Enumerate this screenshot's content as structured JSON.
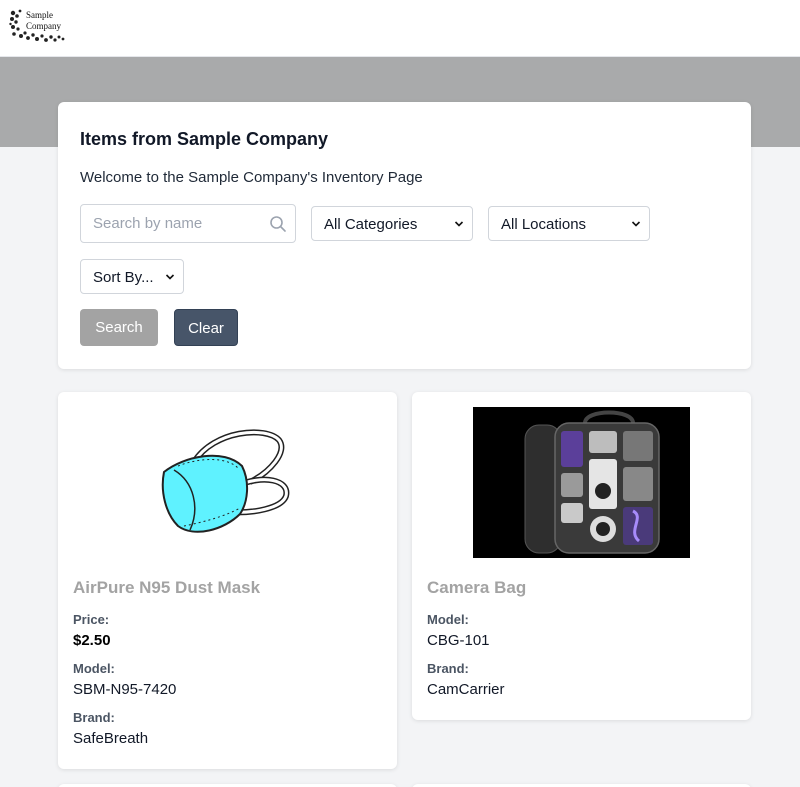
{
  "header": {
    "logo_text_line1": "Sample",
    "logo_text_line2": "Company"
  },
  "filters": {
    "title": "Items from Sample Company",
    "subtitle": "Welcome to the Sample Company's Inventory Page",
    "search": {
      "placeholder": "Search by name",
      "value": ""
    },
    "category_select": {
      "selected": "All Categories"
    },
    "location_select": {
      "selected": "All Locations"
    },
    "sort_select": {
      "selected": "Sort By..."
    },
    "search_button": "Search",
    "clear_button": "Clear"
  },
  "products": [
    {
      "name": "AirPure N95 Dust Mask",
      "price_label": "Price:",
      "price": "$2.50",
      "model_label": "Model:",
      "model": "SBM-N95-7420",
      "brand_label": "Brand:",
      "brand": "SafeBreath"
    },
    {
      "name": "Camera Bag",
      "model_label": "Model:",
      "model": "CBG-101",
      "brand_label": "Brand:",
      "brand": "CamCarrier"
    }
  ],
  "colors": {
    "hero_band": "#a9aaab",
    "page_bg": "#f3f4f6",
    "search_button_bg": "#a3a3a3",
    "clear_button_bg": "#475569",
    "product_name": "#a3a3a3",
    "mask_fill": "#5ff2ff"
  }
}
